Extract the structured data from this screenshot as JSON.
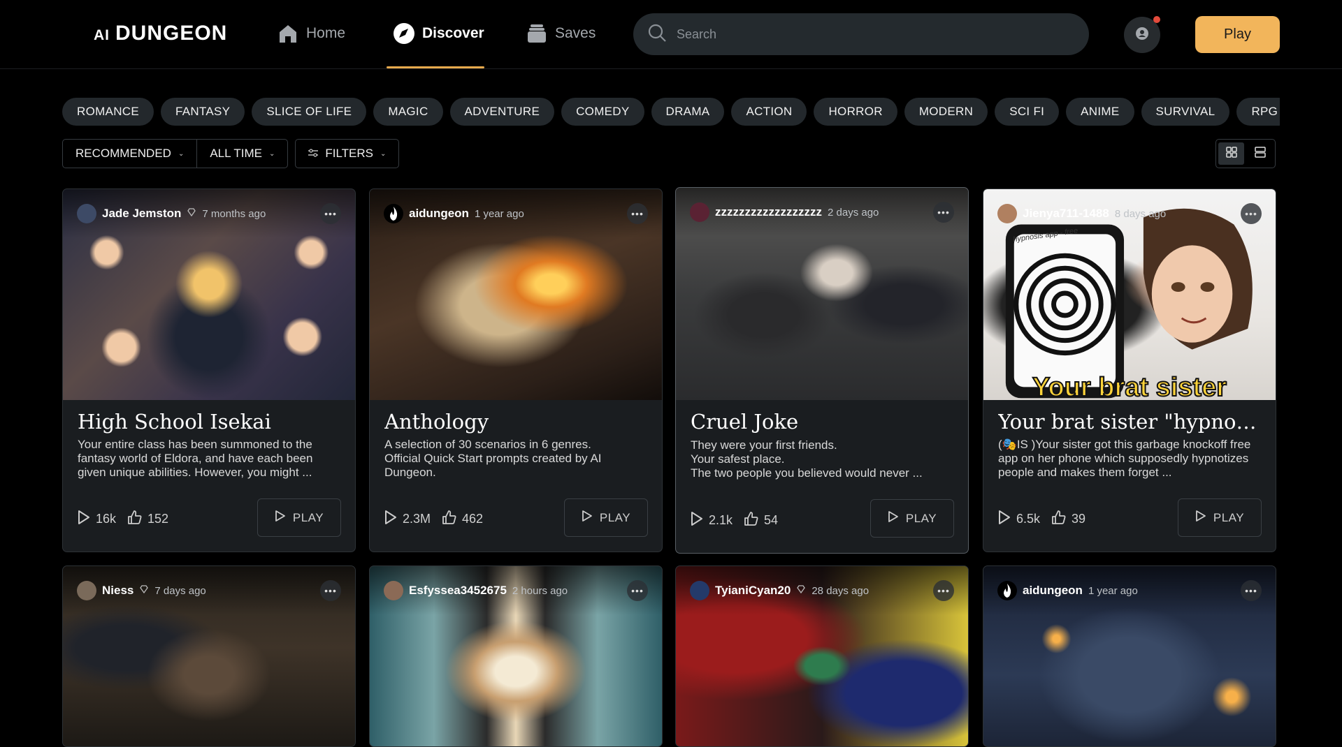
{
  "brand": {
    "ai": "AI",
    "name": "DUNGEON"
  },
  "nav": [
    {
      "label": "Home",
      "icon": "home-icon"
    },
    {
      "label": "Discover",
      "icon": "compass-icon",
      "active": true
    },
    {
      "label": "Saves",
      "icon": "stack-icon"
    }
  ],
  "search": {
    "placeholder": "Search"
  },
  "header": {
    "play_label": "Play",
    "accent": "#f2b55b"
  },
  "genres": [
    "ROMANCE",
    "FANTASY",
    "SLICE OF LIFE",
    "MAGIC",
    "ADVENTURE",
    "COMEDY",
    "DRAMA",
    "ACTION",
    "HORROR",
    "MODERN",
    "SCI FI",
    "ANIME",
    "SURVIVAL",
    "RPG",
    ""
  ],
  "sort": {
    "order": "RECOMMENDED",
    "range": "ALL TIME",
    "filters": "FILTERS"
  },
  "card_play_label": "PLAY",
  "cards": [
    {
      "user": "Jade Jemston",
      "badge": true,
      "time": "7 months ago",
      "title": "High School Isekai",
      "desc": "Your entire class has been summoned to the fantasy world of Eldora, and have each been given unique abilities. However, you might ...",
      "plays": "16k",
      "likes": "152"
    },
    {
      "user": "aidungeon",
      "badge": false,
      "time": "1 year ago",
      "title": "Anthology",
      "desc": "A selection of 30 scenarios in 6 genres.\nOfficial Quick Start prompts created by AI Dungeon.",
      "plays": "2.3M",
      "likes": "462"
    },
    {
      "user": "zzzzzzzzzzzzzzzzzz",
      "badge": false,
      "time": "2 days ago",
      "title": "Cruel Joke",
      "desc": "They were your first friends.\nYour safest place.\nThe two people you believed would never ...",
      "plays": "2.1k",
      "likes": "54"
    },
    {
      "user": "Jienya711-1488",
      "badge": false,
      "time": "8 days ago",
      "title": "Your brat sister \"hypnotize...",
      "desc": "(🎭IS )Your sister got this garbage knockoff free app on her phone which supposedly hypnotizes people and makes them forget ...",
      "plays": "6.5k",
      "likes": "39",
      "image_text": "Your brat sister",
      "image_subtext": "hypnosis app - free"
    },
    {
      "user": "Niess",
      "badge": true,
      "time": "7 days ago"
    },
    {
      "user": "Esfyssea3452675",
      "badge": false,
      "time": "2 hours ago"
    },
    {
      "user": "TyianiCyan20",
      "badge": true,
      "time": "28 days ago"
    },
    {
      "user": "aidungeon",
      "badge": false,
      "time": "1 year ago"
    }
  ]
}
